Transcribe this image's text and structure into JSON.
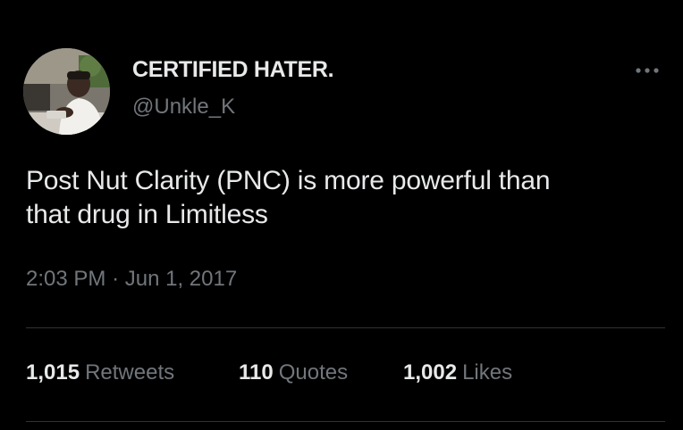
{
  "user": {
    "display_name": "CERTIFIED HATER.",
    "handle": "@Unkle_K",
    "avatar_icon": "profile-photo"
  },
  "tweet": {
    "text": "Post Nut Clarity (PNC) is more powerful than\nthat drug in Limitless",
    "time": "2:03 PM",
    "separator": "·",
    "date": "Jun 1, 2017"
  },
  "stats": {
    "retweets_count": "1,015",
    "retweets_label": "Retweets",
    "quotes_count": "110",
    "quotes_label": "Quotes",
    "likes_count": "1,002",
    "likes_label": "Likes"
  },
  "colors": {
    "background": "#000000",
    "primary_text": "#e7e9ea",
    "secondary_text": "#71767b",
    "divider": "#2f3336"
  },
  "icons": {
    "more": "more-horizontal-icon"
  }
}
